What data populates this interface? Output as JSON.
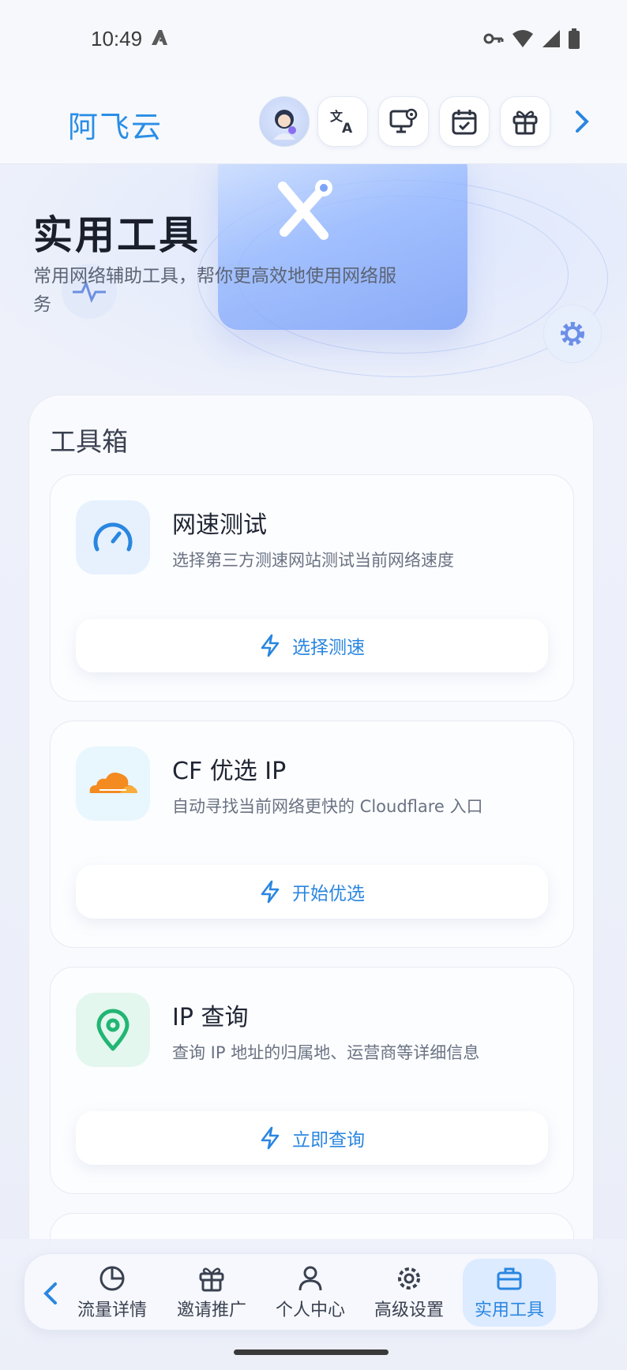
{
  "status_bar": {
    "time": "10:49"
  },
  "header": {
    "app_title": "阿飞云",
    "buttons": [
      {
        "icon": "avatar"
      },
      {
        "icon": "translate-icon"
      },
      {
        "icon": "monitor-settings-icon"
      },
      {
        "icon": "calendar-check-icon"
      },
      {
        "icon": "gift-icon"
      },
      {
        "icon": "chevron-right-icon"
      }
    ]
  },
  "hero": {
    "title": "实用工具",
    "subtitle": "常用网络辅助工具，帮你更高效地使用网络服务"
  },
  "toolbox": {
    "title": "工具箱",
    "cards": [
      {
        "title": "网速测试",
        "description": "选择第三方测速网站测试当前网络速度",
        "button": "选择测速",
        "icon": "speedometer-icon",
        "icon_color": "#2a86e0",
        "icon_bg": "#e6f1fd"
      },
      {
        "title": "CF 优选 IP",
        "description": "自动寻找当前网络更快的 Cloudflare 入口",
        "button": "开始优选",
        "icon": "cloud-icon",
        "icon_color": "#f38b21",
        "icon_bg": "#e8f6fd"
      },
      {
        "title": "IP 查询",
        "description": "查询 IP 地址的归属地、运营商等详细信息",
        "button": "立即查询",
        "icon": "location-pin-icon",
        "icon_color": "#22b573",
        "icon_bg": "#e3f7ee"
      }
    ]
  },
  "bottom_nav": {
    "items": [
      {
        "label": "流量详情",
        "icon": "pie-chart-icon"
      },
      {
        "label": "邀请推广",
        "icon": "gift-icon"
      },
      {
        "label": "个人中心",
        "icon": "user-icon"
      },
      {
        "label": "高级设置",
        "icon": "gear-icon"
      },
      {
        "label": "实用工具",
        "icon": "toolbox-icon",
        "active": true
      }
    ]
  },
  "colors": {
    "accent": "#2a86e0",
    "title": "#2a8ee6"
  }
}
